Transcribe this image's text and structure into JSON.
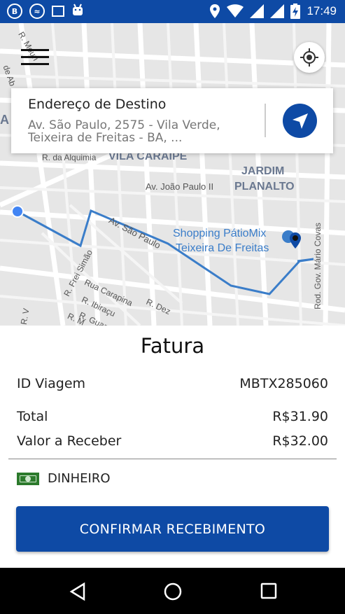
{
  "status_bar": {
    "time": "17:49",
    "icons": [
      "b-icon",
      "cloud-icon",
      "image-icon",
      "android-icon",
      "location-icon",
      "wifi-icon",
      "signal-icon",
      "signal-icon",
      "battery-charging-icon"
    ]
  },
  "map": {
    "labels": {
      "r_mouri": "R. Mouri",
      "de_ab": "de Ab",
      "r_alquimia": "R. da Alquimia",
      "vila_caraipe": "VILA CARAIPE",
      "jardim": "JARDIM",
      "planalto": "PLANALTO",
      "av_joao_paulo": "Av. João Paulo II",
      "av_sao_paulo": "Av. São Paulo",
      "shopping_1": "Shopping PátioMix",
      "shopping_2": "Teixeira De Freitas",
      "r_frei_simao": "R. Frei Simão",
      "rua_carapina": "Rua Carapina",
      "r_ibiracu": "R. Ibiraçu",
      "r_guar": "R. Guar",
      "r_dez": "R. Dez",
      "rod_gov": "Rod. Gov. Mário Covas",
      "a_left": "A",
      "r_v": "R. V",
      "r_m": "R. M"
    },
    "route_color": "#3a7dc9",
    "accent": "#0e4aa5"
  },
  "destination": {
    "title": "Endereço de Destino",
    "address": "Av. São Paulo, 2575 - Vila Verde, Teixeira de Freitas - BA, ..."
  },
  "invoice": {
    "title": "Fatura",
    "trip_id_label": "ID Viagem",
    "trip_id_value": "MBTX285060",
    "total_label": "Total",
    "total_value": "R$31.90",
    "receive_label": "Valor a Receber",
    "receive_value": "R$32.00",
    "payment_method": "DINHEIRO",
    "confirm_label": "CONFIRMAR RECEBIMENTO"
  }
}
